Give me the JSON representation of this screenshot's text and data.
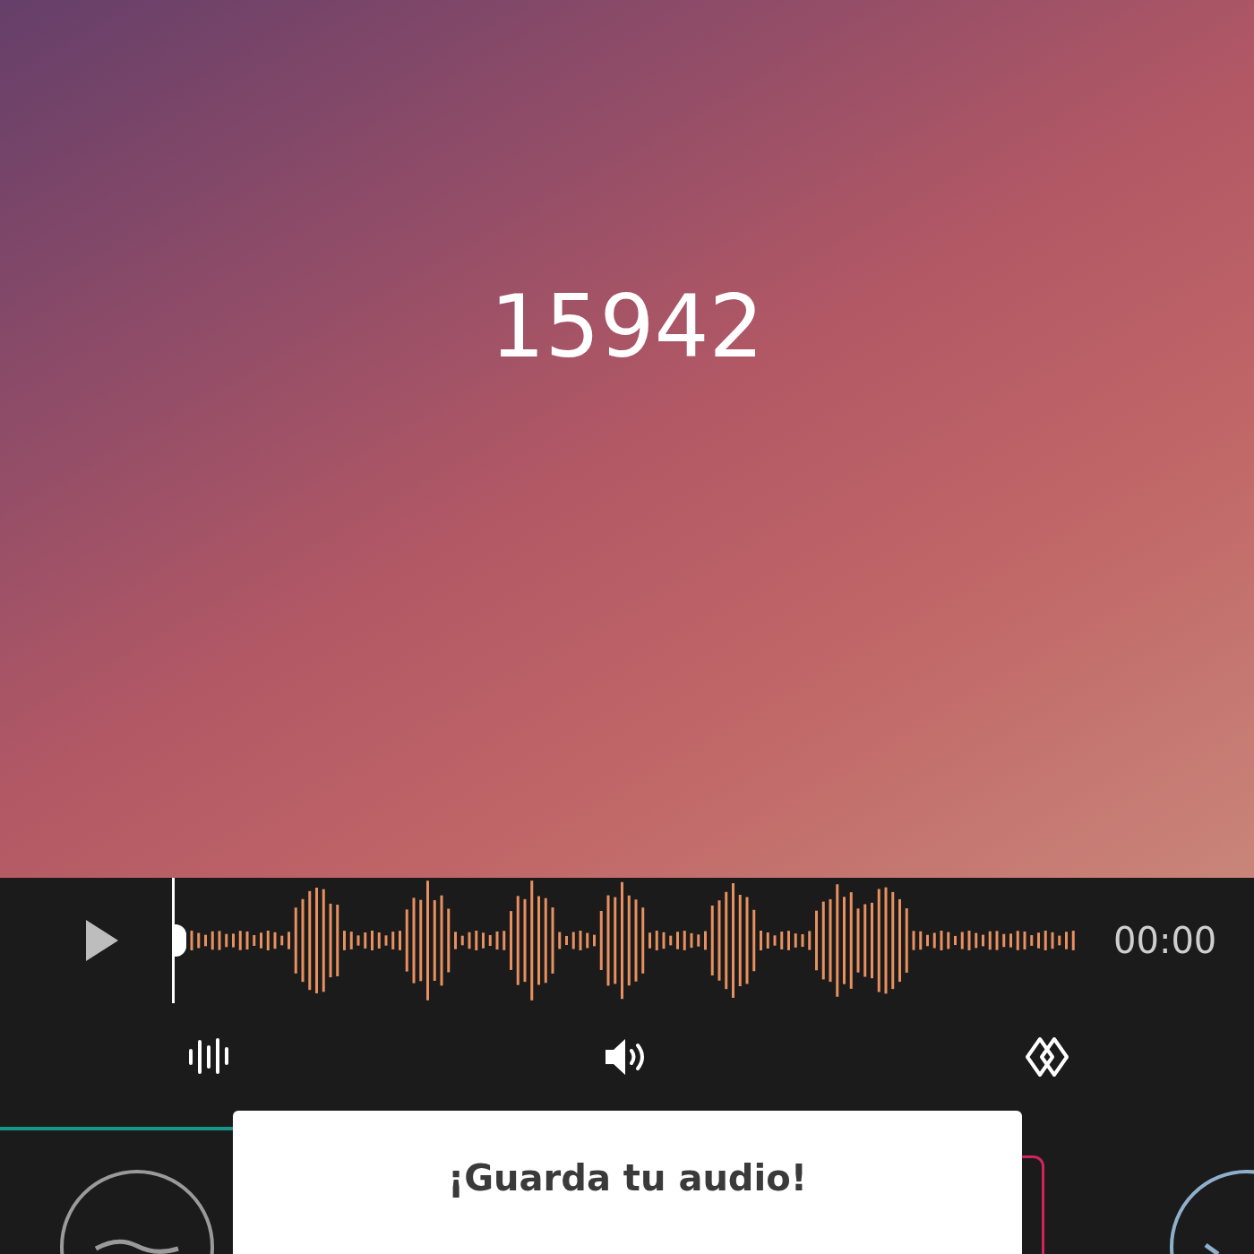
{
  "counter": "15942",
  "player": {
    "time": "00:00"
  },
  "dialog": {
    "title": "¡Guarda tu audio!"
  }
}
